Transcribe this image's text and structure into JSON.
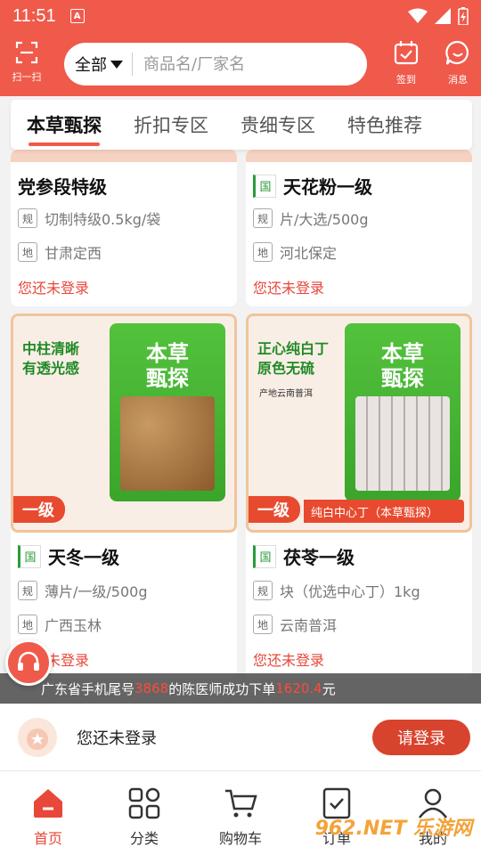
{
  "status_bar": {
    "time": "11:51",
    "app_badge": "A"
  },
  "header": {
    "scan_label": "扫一扫",
    "category": "全部",
    "search_placeholder": "商品名/厂家名",
    "checkin_label": "签到",
    "message_label": "消息",
    "accent_color": "#ef5a4b"
  },
  "tabs": [
    "本草甄探",
    "折扣专区",
    "贵细专区",
    "特色推荐"
  ],
  "products": [
    {
      "title": "党参段特级",
      "has_guo": false,
      "spec_tag": "规",
      "spec": "切制特级0.5kg/袋",
      "origin_tag": "地",
      "origin": "甘肃定西",
      "login_note": "您还未登录"
    },
    {
      "title": "天花粉一级",
      "has_guo": true,
      "guo": "国",
      "spec_tag": "规",
      "spec": "片/大选/500g",
      "origin_tag": "地",
      "origin": "河北保定",
      "login_note": "您还未登录"
    },
    {
      "title": "天冬一级",
      "has_guo": true,
      "guo": "国",
      "spec_tag": "规",
      "spec": "薄片/一级/500g",
      "origin_tag": "地",
      "origin": "广西玉林",
      "login_note": "您还未登录",
      "image": {
        "slogan_1": "中柱清晰",
        "slogan_2": "有透光感",
        "brand": "本草\n甄探",
        "grade": "一级"
      }
    },
    {
      "title": "茯苓一级",
      "has_guo": true,
      "guo": "国",
      "spec_tag": "规",
      "spec": "块（优选中心丁）1kg",
      "origin_tag": "地",
      "origin": "云南普洱",
      "login_note": "您还未登录",
      "image": {
        "slogan_1": "正心纯白丁",
        "slogan_2": "原色无硫",
        "origin_text": "产地云南普洱",
        "brand": "本草\n甄探",
        "grade": "一级",
        "ribbon": "纯白中心丁（本草甄探）"
      }
    }
  ],
  "ticker": {
    "prefix": "广东省手机尾号",
    "phone": "3868",
    "middle": "的陈医师成功下单",
    "amount": "1620.4",
    "suffix": "元"
  },
  "login_bar": {
    "text": "您还未登录",
    "button": "请登录"
  },
  "bottom_nav": [
    {
      "label": "首页",
      "icon": "home-icon",
      "active": true
    },
    {
      "label": "分类",
      "icon": "category-icon",
      "active": false
    },
    {
      "label": "购物车",
      "icon": "cart-icon",
      "active": false
    },
    {
      "label": "订单",
      "icon": "order-icon",
      "active": false
    },
    {
      "label": "我的",
      "icon": "user-icon",
      "active": false
    }
  ],
  "watermark": "962.NET 乐游网"
}
